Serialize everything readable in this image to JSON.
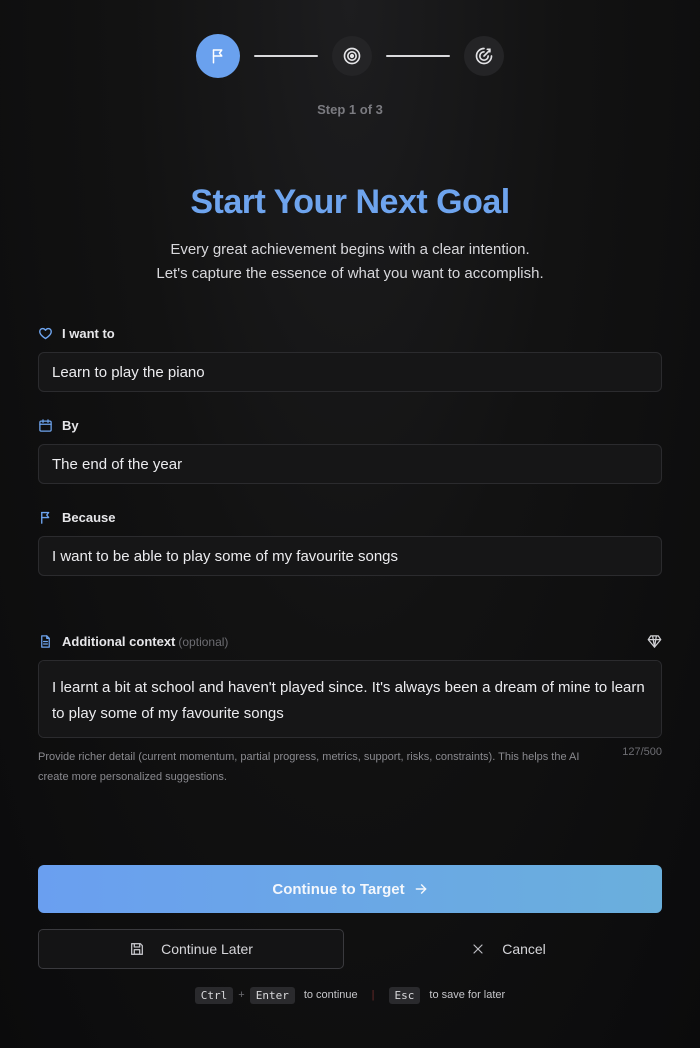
{
  "stepper": {
    "counter": "Step 1 of 3",
    "steps": [
      {
        "icon": "flag-icon",
        "state": "active"
      },
      {
        "icon": "target-icon",
        "state": "inactive"
      },
      {
        "icon": "chart-icon",
        "state": "inactive"
      }
    ]
  },
  "header": {
    "title": "Start Your Next Goal",
    "subtitle_line1": "Every great achievement begins with a clear intention.",
    "subtitle_line2": "Let's capture the essence of what you want to accomplish."
  },
  "form": {
    "want": {
      "label": "I want to",
      "value": "Learn to play the piano"
    },
    "by": {
      "label": "By",
      "value": "The end of the year"
    },
    "because": {
      "label": "Because",
      "value": "I want to be able to play some of my favourite songs"
    },
    "context": {
      "label": "Additional context",
      "optional": "(optional)",
      "value": "I learnt a bit at school and haven't played since. It's always been a dream of mine to learn to play some of my favourite songs",
      "help": "Provide richer detail (current momentum, partial progress, metrics, support, risks, constraints). This helps the AI create more personalized suggestions.",
      "count": "127/500"
    }
  },
  "actions": {
    "continue": "Continue to Target",
    "later": "Continue Later",
    "cancel": "Cancel"
  },
  "shortcuts": {
    "key1": "Ctrl",
    "plus": "+",
    "key2": "Enter",
    "continue_text": "to continue",
    "separator": "|",
    "key3": "Esc",
    "later_text": "to save for later"
  },
  "colors": {
    "accent": "#6aa1ee",
    "background": "#121212",
    "input_bg": "#161617"
  }
}
